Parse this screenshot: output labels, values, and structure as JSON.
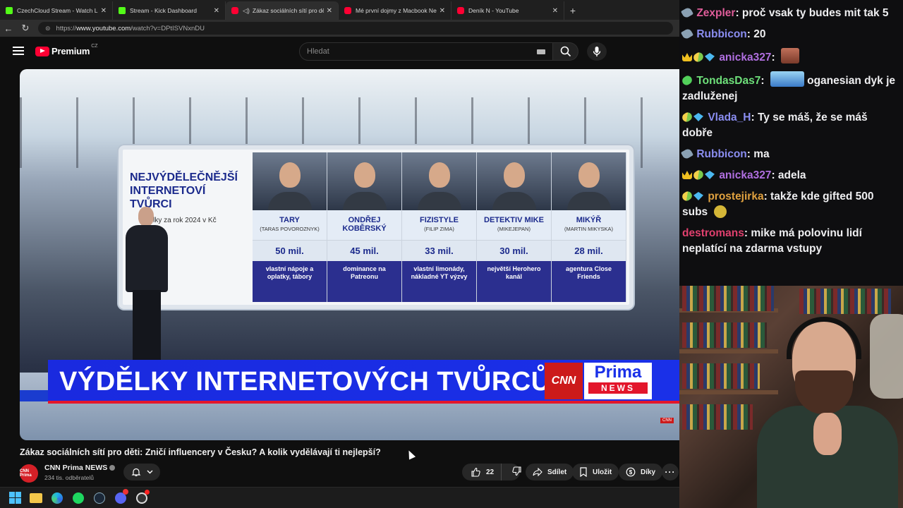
{
  "tabs": [
    {
      "title": "CzechCloud Stream - Watch Live o",
      "icon": "kick"
    },
    {
      "title": "Stream - Kick Dashboard",
      "icon": "kick"
    },
    {
      "title": "Zákaz sociálních sítí pro děti: Z",
      "icon": "youtube",
      "active": true
    },
    {
      "title": "Mé první dojmy z Macbook Neo. Z",
      "icon": "youtube"
    },
    {
      "title": "Deník N - YouTube",
      "icon": "youtube"
    }
  ],
  "address": {
    "prefix": "https://",
    "host": "www.youtube.com",
    "path": "/watch?v=DPtISVNxnDU"
  },
  "youtube": {
    "brand": "Premium",
    "country": "CZ",
    "search_placeholder": "Hledat"
  },
  "video": {
    "board_heading": "NEJVÝDĚLEČNĚJŠÍ INTERNETOVÍ TVŮRCI",
    "board_sub": "výdělky za rok 2024 v Kč",
    "creators": [
      {
        "name": "TARY",
        "real": "(TARAS POVOROZNYK)",
        "earn": "50 mil.",
        "desc": "vlastní nápoje a oplatky, tábory"
      },
      {
        "name": "ONDŘEJ KOBĚRSKÝ",
        "real": "",
        "earn": "45 mil.",
        "desc": "dominance na Patreonu"
      },
      {
        "name": "FIZISTYLE",
        "real": "(FILIP ZIMA)",
        "earn": "33 mil.",
        "desc": "vlastní limonády, nákladné YT výzvy"
      },
      {
        "name": "DETEKTIV MIKE",
        "real": "(MIKEJEPAN)",
        "earn": "30 mil.",
        "desc": "největší Herohero kanál"
      },
      {
        "name": "MIKÝŘ",
        "real": "(MARTIN MIKYSKA)",
        "earn": "28 mil.",
        "desc": "agentura Close Friends"
      }
    ],
    "lower_third": "VÝDĚLKY INTERNETOVÝCH TVŮRCŮ",
    "cnn": "CNN",
    "prima": "Prima",
    "news": "NEWS",
    "title": "Zákaz sociálních sítí pro děti: Zničí influencery v Česku? A kolik vydělávají ti nejlepší?",
    "channel": "CNN Prima NEWS",
    "channel_avatar": "CNN Prima",
    "subscribers": "234 tis. odběratelů",
    "likes": "22",
    "share": "Sdílet",
    "save": "Uložit",
    "thanks": "Díky"
  },
  "chat": [
    {
      "badges": [
        "wrench"
      ],
      "user": "Zexpler",
      "color": "#e05d9a",
      "text": "proč vsak ty budes mit tak 5"
    },
    {
      "badges": [
        "wrench"
      ],
      "user": "Rubbicon",
      "color": "#8a8df0",
      "text": "20"
    },
    {
      "badges": [
        "crown",
        "pill",
        "gem"
      ],
      "user": "anicka327",
      "color": "#b06fe0",
      "text": "",
      "emote": "face"
    },
    {
      "badges": [
        "green"
      ],
      "user": "TondasDas7",
      "color": "#6ee07a",
      "text": "oganesian dyk je zadluženej",
      "emote": "car"
    },
    {
      "badges": [
        "pill",
        "gem"
      ],
      "user": "Vlada_H",
      "color": "#8a8df0",
      "text": "Ty se máš, že se máš dobře"
    },
    {
      "badges": [
        "wrench"
      ],
      "user": "Rubbicon",
      "color": "#8a8df0",
      "text": "ma"
    },
    {
      "badges": [
        "crown",
        "pill",
        "gem"
      ],
      "user": "anicka327",
      "color": "#b06fe0",
      "text": "adela"
    },
    {
      "badges": [
        "pill",
        "gem"
      ],
      "user": "prostejirka",
      "color": "#e0a13f",
      "text": "takže kde gifted 500 subs",
      "emote": "mini"
    },
    {
      "badges": [],
      "user": "destromans",
      "color": "#e0406e",
      "text": "mike má polovinu lidí neplatící na zdarma vstupy"
    }
  ]
}
